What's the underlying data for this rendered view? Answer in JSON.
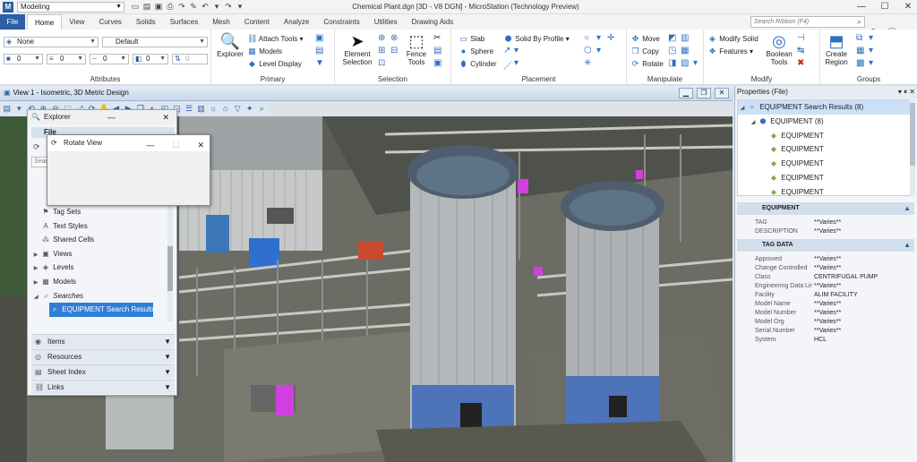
{
  "titlebar": {
    "workflow": "Modeling",
    "window_title": "Chemical Plant.dgn [3D - V8 DGN] - MicroStation (Technology Preview)"
  },
  "tabs": {
    "file": "File",
    "items": [
      "Home",
      "View",
      "Curves",
      "Solids",
      "Surfaces",
      "Mesh",
      "Content",
      "Analyze",
      "Constraints",
      "Utilities",
      "Drawing Aids"
    ],
    "active": "Home",
    "search_placeholder": "Search Ribbon (F4)"
  },
  "ribbon": {
    "attributes": {
      "label": "Attributes",
      "level": "None",
      "style": "Default",
      "color_value": "0",
      "weight_value": "0",
      "linestyle_value": "0",
      "transparency_value": "0",
      "priority_value": "0"
    },
    "primary": {
      "label": "Primary",
      "explorer": "Explorer",
      "attach_tools": "Attach Tools",
      "models": "Models",
      "level_display": "Level Display"
    },
    "selection": {
      "label": "Selection",
      "element_selection": "Element Selection",
      "fence_tools": "Fence Tools"
    },
    "placement": {
      "label": "Placement",
      "slab": "Slab",
      "sphere": "Sphere",
      "cylinder": "Cylinder",
      "solid_by_profile": "Solid By Profile"
    },
    "manipulate": {
      "label": "Manipulate",
      "move": "Move",
      "copy": "Copy",
      "rotate": "Rotate"
    },
    "modify": {
      "label": "Modify",
      "modify_solid": "Modify Solid",
      "features": "Features",
      "boolean_tools": "Boolean Tools"
    },
    "groups": {
      "label": "Groups",
      "create_region": "Create Region"
    }
  },
  "view": {
    "title": "View 1 - Isometric, 3D Metric Design"
  },
  "explorer": {
    "title": "Explorer",
    "file_header": "File",
    "search_placeholder": "Sear",
    "tree": [
      {
        "label": "Tag Sets",
        "icon": "tag-icon",
        "expander": ""
      },
      {
        "label": "Text Styles",
        "icon": "text-style-icon",
        "expander": ""
      },
      {
        "label": "Shared Cells",
        "icon": "cell-icon",
        "expander": ""
      },
      {
        "label": "Views",
        "icon": "views-icon",
        "expander": "▶"
      },
      {
        "label": "Levels",
        "icon": "levels-icon",
        "expander": "▶"
      },
      {
        "label": "Models",
        "icon": "models-icon",
        "expander": "▶"
      }
    ],
    "searches_label": "Searches",
    "selected_item": "EQUIPMENT Search Results",
    "sections": [
      "Items",
      "Resources",
      "Sheet Index",
      "Links"
    ]
  },
  "rotate_dialog": {
    "title": "Rotate View"
  },
  "properties": {
    "title": "Properties (File)",
    "results_label": "EQUIPMENT Search Results (8)",
    "group_label": "EQUIPMENT (8)",
    "items": [
      "EQUIPMENT",
      "EQUIPMENT",
      "EQUIPMENT",
      "EQUIPMENT",
      "EQUIPMENT"
    ],
    "equipment_section": "EQUIPMENT",
    "equipment_rows": [
      {
        "key": "TAG",
        "value": "**Varies**"
      },
      {
        "key": "DESCRIPTION",
        "value": "**Varies**"
      }
    ],
    "tag_data_section": "TAG DATA",
    "tag_data_rows": [
      {
        "key": "Approved",
        "value": "**Varies**"
      },
      {
        "key": "Change Controlled",
        "value": "**Varies**"
      },
      {
        "key": "Class",
        "value": "CENTRIFUGAL PUMP"
      },
      {
        "key": "Engineering Data Lir",
        "value": "**Varies**"
      },
      {
        "key": "Facility",
        "value": "ALIM FACILITY"
      },
      {
        "key": "Model Name",
        "value": "**Varies**"
      },
      {
        "key": "Model Number",
        "value": "**Varies**"
      },
      {
        "key": "Model Org",
        "value": "**Varies**"
      },
      {
        "key": "Serial Number",
        "value": "**Varies**"
      },
      {
        "key": "System",
        "value": "HCL"
      }
    ]
  }
}
